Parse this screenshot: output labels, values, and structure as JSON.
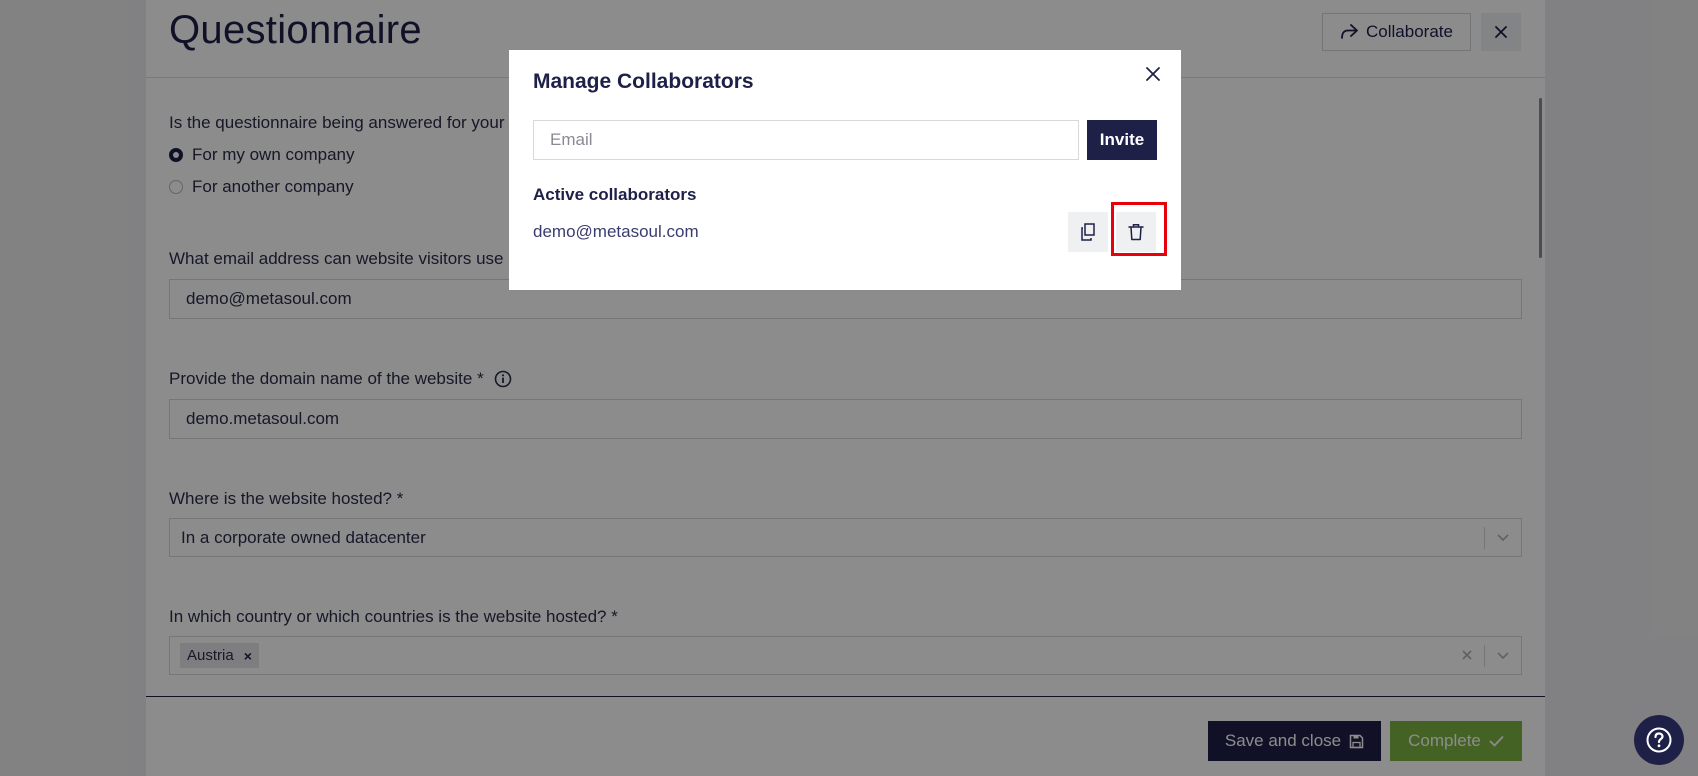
{
  "page": {
    "title": "Questionnaire",
    "collaborate_label": "Collaborate"
  },
  "questions": {
    "q1": {
      "label": "Is the questionnaire being answered for your",
      "options": [
        "For my own company",
        "For another company"
      ],
      "selected": "For my own company"
    },
    "q2": {
      "label": "What email address can website visitors use",
      "value": "demo@metasoul.com"
    },
    "q3": {
      "label": "Provide the domain name of the website *",
      "value": "demo.metasoul.com"
    },
    "q4": {
      "label": "Where is the website hosted? *",
      "value": "In a corporate owned datacenter"
    },
    "q5": {
      "label": "In which country or which countries is the website hosted? *",
      "tags": [
        "Austria"
      ]
    }
  },
  "footer": {
    "save_label": "Save and close",
    "complete_label": "Complete"
  },
  "modal": {
    "title": "Manage Collaborators",
    "email_placeholder": "Email",
    "invite_label": "Invite",
    "active_heading": "Active collaborators",
    "collaborators": [
      {
        "email": "demo@metasoul.com"
      }
    ]
  },
  "colors": {
    "brand_navy": "#1e2048",
    "complete_green": "#7cb342",
    "highlight_red": "#e8000b"
  },
  "icons": {
    "collaborate": "share-arrow-icon",
    "close": "close-icon",
    "info": "info-icon",
    "chevron": "chevron-down-icon",
    "save": "floppy-disk-icon",
    "complete": "checkmark-icon",
    "copy": "copy-icon",
    "delete": "trash-icon",
    "help": "question-mark-icon"
  }
}
